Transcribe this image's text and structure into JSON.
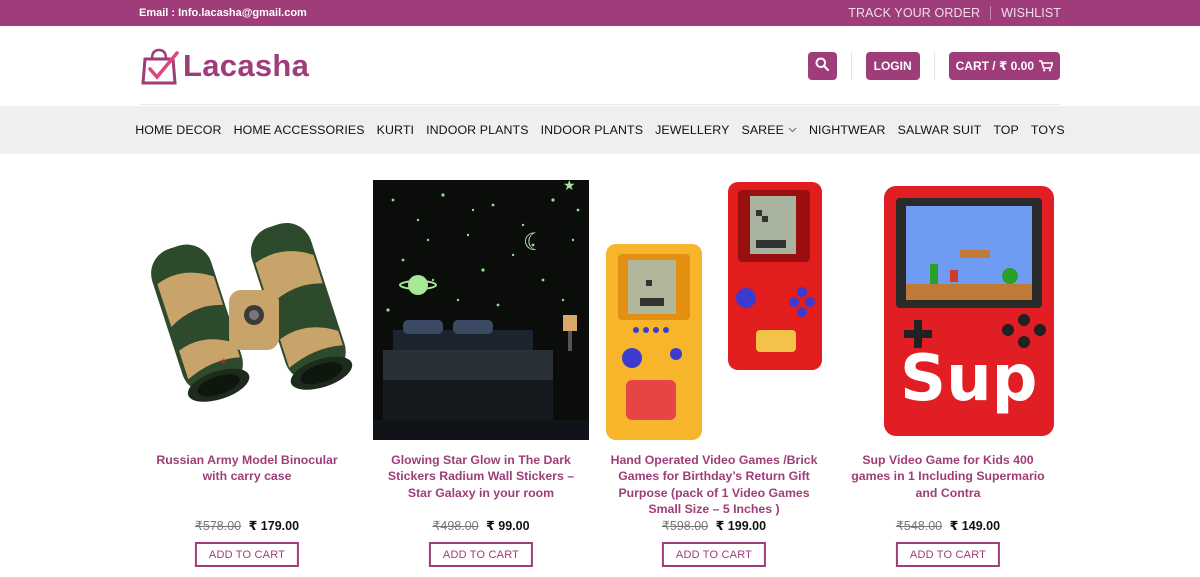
{
  "topbar": {
    "email": "Email : Info.lacasha@gmail.com",
    "track_order": "TRACK YOUR ORDER",
    "wishlist": "WISHLIST"
  },
  "header": {
    "logo_text": "Lacasha",
    "search_icon": "search-icon",
    "login_label": "LOGIN",
    "cart_label": "CART / ₹ 0.00",
    "cart_icon": "cart-icon"
  },
  "nav": {
    "items": [
      {
        "label": "HOME DECOR"
      },
      {
        "label": "HOME ACCESSORIES"
      },
      {
        "label": "KURTI"
      },
      {
        "label": "INDOOR PLANTS"
      },
      {
        "label": "INDOOR PLANTS"
      },
      {
        "label": "JEWELLERY"
      },
      {
        "label": "SAREE"
      },
      {
        "label": "NIGHTWEAR"
      },
      {
        "label": "SALWAR SUIT"
      },
      {
        "label": "TOP"
      },
      {
        "label": "TOYS"
      }
    ]
  },
  "products": [
    {
      "title": "Russian Army Model Binocular with carry case",
      "old_price": "₹578.00",
      "price": "₹ 179.00",
      "cta": "ADD TO CART"
    },
    {
      "title": "Glowing Star Glow in The Dark Stickers Radium Wall Stickers – Star Galaxy in your room",
      "old_price": "₹498.00",
      "price": "₹ 99.00",
      "cta": "ADD TO CART"
    },
    {
      "title": "Hand Operated Video Games /Brick Games for Birthday’s Return Gift Purpose (pack of 1 Video Games Small Size – 5 Inches )",
      "old_price": "₹598.00",
      "price": "₹ 199.00",
      "cta": "ADD TO CART"
    },
    {
      "title": "Sup Video Game for Kids 400 games in 1 Including Supermario and Contra",
      "old_price": "₹548.00",
      "price": "₹ 149.00",
      "cta": "ADD TO CART"
    }
  ],
  "colors": {
    "brand": "#9e3d79",
    "nav_bg": "#efefef"
  }
}
